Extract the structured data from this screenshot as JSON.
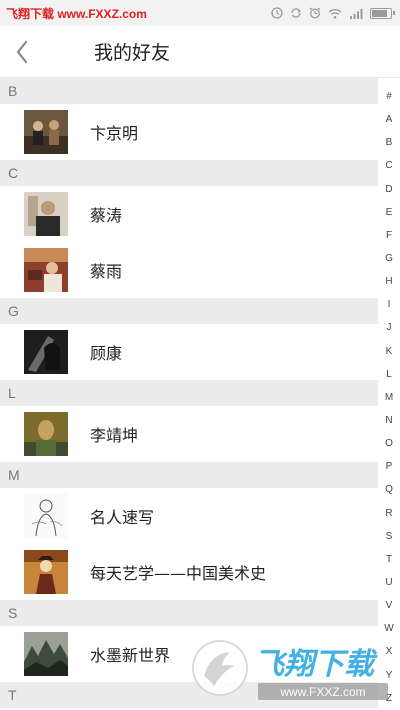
{
  "status_bar": {
    "watermark_text": "飞翔下载 www.FXXZ.com",
    "icons": [
      "clock-icon",
      "sync-icon",
      "alarm-icon",
      "wifi-icon",
      "signal-icon",
      "battery-icon"
    ]
  },
  "header": {
    "back_icon": "chevron-left-icon",
    "title": "我的好友"
  },
  "sections": [
    {
      "letter": "B",
      "items": [
        {
          "name": "卞京明",
          "avatar_color": "#5a4632"
        }
      ]
    },
    {
      "letter": "C",
      "items": [
        {
          "name": "蔡涛",
          "avatar_color": "#3a3a3a"
        },
        {
          "name": "蔡雨",
          "avatar_color": "#8b3b2a"
        }
      ]
    },
    {
      "letter": "G",
      "items": [
        {
          "name": "顾康",
          "avatar_color": "#2b2b2b"
        }
      ]
    },
    {
      "letter": "L",
      "items": [
        {
          "name": "李靖坤",
          "avatar_color": "#7a6a2a"
        }
      ]
    },
    {
      "letter": "M",
      "items": [
        {
          "name": "名人速写",
          "avatar_color": "#d8d8d8"
        },
        {
          "name": "每天艺学——中国美术史",
          "avatar_color": "#b8732a"
        }
      ]
    },
    {
      "letter": "S",
      "items": [
        {
          "name": "水墨新世界",
          "avatar_color": "#6e7a6a"
        }
      ]
    },
    {
      "letter": "T",
      "items": []
    }
  ],
  "index_letters": [
    "#",
    "A",
    "B",
    "C",
    "D",
    "E",
    "F",
    "G",
    "H",
    "I",
    "J",
    "K",
    "L",
    "M",
    "N",
    "O",
    "P",
    "Q",
    "R",
    "S",
    "T",
    "U",
    "V",
    "W",
    "X",
    "Y",
    "Z"
  ],
  "watermark": {
    "brand": "飞翔下载",
    "url": "www.FXXZ.com",
    "accent": "#2aa6e0"
  }
}
